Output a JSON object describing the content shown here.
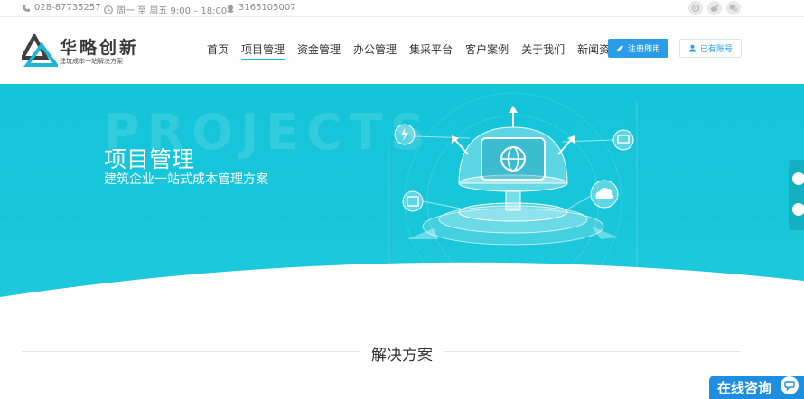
{
  "topbar": {
    "phone": "028-87735257",
    "hours": "周一 至 周五 9:00 – 18:00",
    "qq": "3165105007"
  },
  "logo": {
    "title": "华略创新",
    "subtitle": "建筑成本一站解决方案"
  },
  "nav": {
    "items": [
      {
        "label": "首页"
      },
      {
        "label": "项目管理"
      },
      {
        "label": "资金管理"
      },
      {
        "label": "办公管理"
      },
      {
        "label": "集采平台"
      },
      {
        "label": "客户案例"
      },
      {
        "label": "关于我们"
      },
      {
        "label": "新闻资讯"
      }
    ],
    "active": "项目管理"
  },
  "auth": {
    "register_label": "注册即用",
    "login_label": "已有账号"
  },
  "banner": {
    "watermark": "PROJECTS",
    "title": "项目管理",
    "subtitle": "建筑企业一站式成本管理方案"
  },
  "section": {
    "title": "解决方案"
  },
  "consult": {
    "label": "在线咨询"
  },
  "colors": {
    "accent": "#1fb6d6",
    "button_blue": "#2a9de6",
    "banner": "#18c6da"
  },
  "icons": {
    "topbar": [
      "phone-icon",
      "clock-icon",
      "qq-icon"
    ],
    "social": [
      "wechat-moments-icon",
      "weibo-icon",
      "wechat-icon"
    ]
  }
}
